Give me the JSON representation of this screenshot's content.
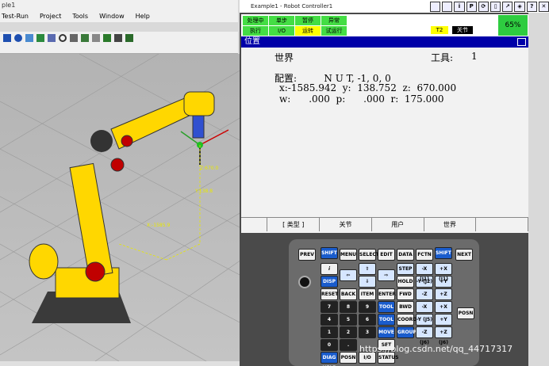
{
  "app": {
    "title": "ple1",
    "menu": [
      "Test-Run",
      "Project",
      "Tools",
      "Window",
      "Help"
    ]
  },
  "viewport": {
    "label_z": "Z:670.0",
    "label_y": "Y:138.8",
    "label_x": "X:-1585.9"
  },
  "pendant": {
    "title": "Example1 - Robot Controller1",
    "status_row1": [
      "处理中",
      "单步",
      "暂停",
      "异常"
    ],
    "status_row2": [
      "执行",
      "I/O",
      "运转",
      "试运行"
    ],
    "mode": "T2",
    "state": "关节",
    "override": "65%",
    "icon_labels": [
      "i",
      "P"
    ],
    "screen_title": "位置",
    "frame": "世界",
    "tool_label": "工具:",
    "tool_value": "1",
    "config_line": "配置:         N U T, -1, 0, 0",
    "xyz_line": "x:-1585.942  y:  138.752  z:  670.000",
    "wpr_line": "w:      .000  p:      .000  r:  175.000",
    "fkeys": [
      "[ 类型 ]",
      "关节",
      "用户",
      "世界",
      ""
    ]
  },
  "keys": {
    "row_top": [
      "PREV",
      "SHIFT",
      "MENU",
      "SELECT",
      "EDIT",
      "DATA",
      "FCTN",
      "SHIFT",
      "NEXT"
    ],
    "disp": "DISP",
    "step": "STEP",
    "hold": "HOLD",
    "fwd": "FWD",
    "bwd": "BWD",
    "coord": "COORD",
    "group": "GROUP",
    "reset": "RESET",
    "back": "BACK SPACE",
    "item": "ITEM",
    "enter": "ENTER",
    "tool1": "TOOL 1",
    "tool2": "TOOL 2",
    "move_menu": "MOVE MENU",
    "set_up": "SET UP",
    "diag": "DIAG HELP",
    "posn": "POSN",
    "io": "I/O",
    "status": "STATUS",
    "posn_side": "POSN",
    "digits": [
      "7",
      "8",
      "9",
      "4",
      "5",
      "6",
      "1",
      "2",
      "3",
      "0",
      "."
    ],
    "jog": [
      "-Y (J2)",
      "+Y (J2)",
      "-X (J1)",
      "+X (J1)",
      "-Z (J3)",
      "+Z (J3)",
      "-X (J4)",
      "+X (J4)",
      "-Y (J5)",
      "+Y (J5)",
      "-Z (J6)",
      "+Z (J6)"
    ]
  },
  "watermark": "https://blog.csdn.net/qq_44717317"
}
